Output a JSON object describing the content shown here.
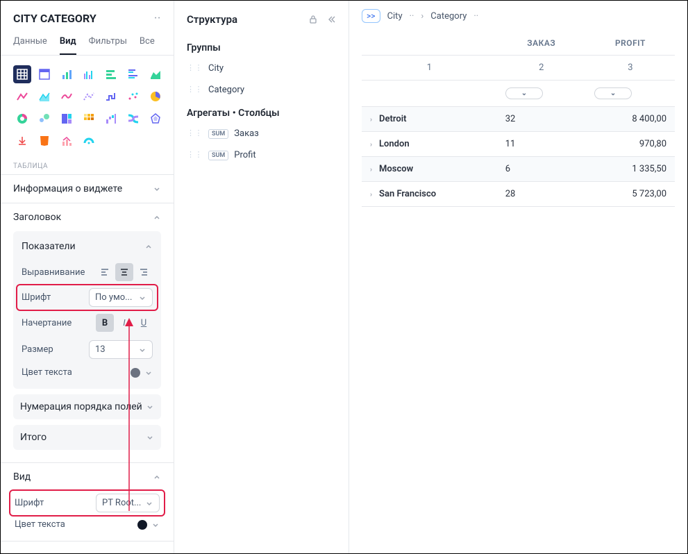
{
  "left": {
    "title": "CITY CATEGORY",
    "tabs": {
      "data": "Данные",
      "view": "Вид",
      "filters": "Фильтры",
      "all": "Все"
    },
    "section_table": "ТАБЛИЦА",
    "widget_info": "Информация о виджете",
    "header_section": "Заголовок",
    "indicators": {
      "title": "Показатели",
      "align_label": "Выравнивание",
      "font_label": "Шрифт",
      "font_value": "По умо...",
      "style_label": "Начертание",
      "size_label": "Размер",
      "size_value": "13",
      "color_label": "Цвет текста"
    },
    "field_numbering": "Нумерация порядка полей",
    "total": "Итого",
    "view_section": {
      "title": "Вид",
      "font_label": "Шрифт",
      "font_value": "PT Root...",
      "color_label": "Цвет текста"
    }
  },
  "mid": {
    "title": "Структура",
    "groups_label": "Группы",
    "groups": [
      "City",
      "Category"
    ],
    "aggregates_label": "Агрегаты • Столбцы",
    "agg_badge": "SUM",
    "aggregates": [
      "Заказ",
      "Profit"
    ]
  },
  "right": {
    "breadcrumb": {
      "expand": ">>",
      "city": "City",
      "category": "Category"
    },
    "columns": {
      "c1": "1",
      "c2": "2",
      "c3": "3",
      "order": "ЗАКАЗ",
      "profit": "PROFIT"
    },
    "filter_glyph": "⌄",
    "rows": [
      {
        "city": "Detroit",
        "order": "32",
        "profit": "8 400,00"
      },
      {
        "city": "London",
        "order": "11",
        "profit": "970,80"
      },
      {
        "city": "Moscow",
        "order": "6",
        "profit": "1 335,50"
      },
      {
        "city": "San Francisco",
        "order": "28",
        "profit": "5 723,00"
      }
    ]
  }
}
